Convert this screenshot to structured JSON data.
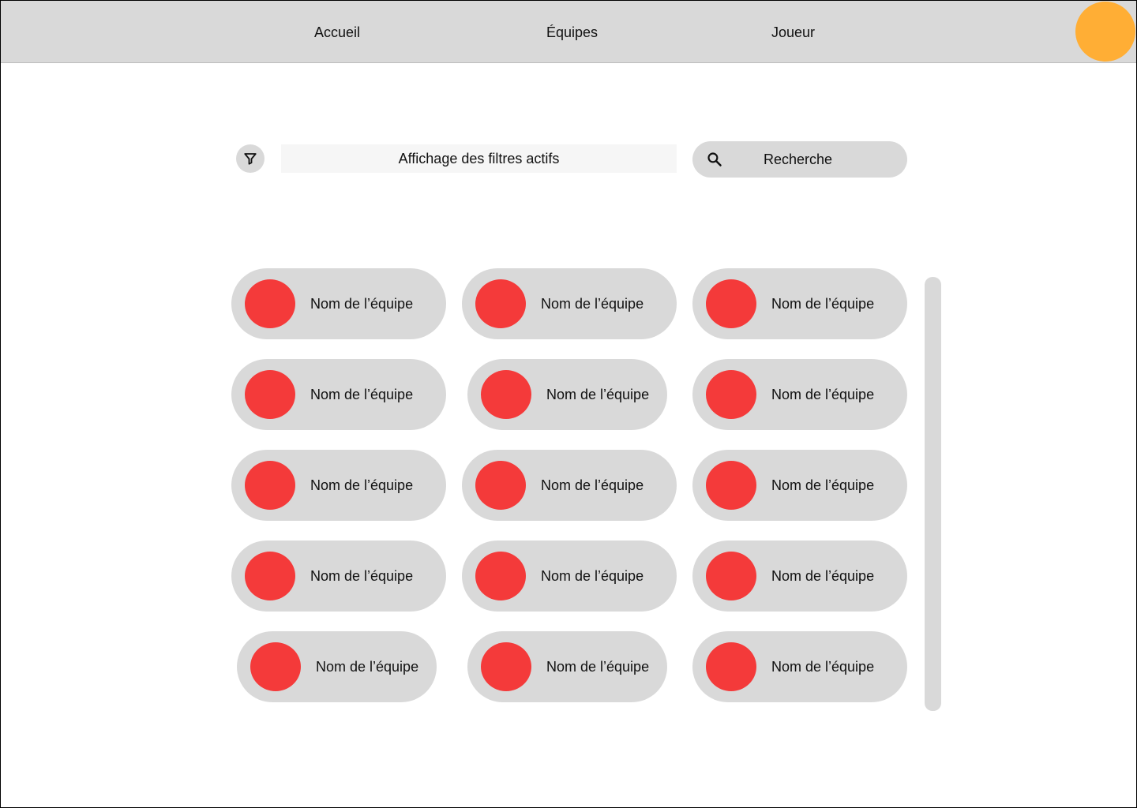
{
  "nav": {
    "links": [
      "Accueil",
      "Équipes",
      "Joueur"
    ],
    "avatar_color": "#ffae35"
  },
  "toolbar": {
    "filter_icon": "filter-icon",
    "active_filters_label": "Affichage des filtres actifs",
    "search_icon": "search-icon",
    "search_placeholder": "Recherche"
  },
  "teams": {
    "logo_color": "#f43a3a",
    "items": [
      "Nom de l’équipe",
      "Nom de l’équipe",
      "Nom de l’équipe",
      "Nom de l’équipe",
      "Nom de l’équipe",
      "Nom de l’équipe",
      "Nom de l’équipe",
      "Nom de l’équipe",
      "Nom de l’équipe",
      "Nom de l’équipe",
      "Nom de l’équipe",
      "Nom de l’équipe",
      "Nom de l’équipe",
      "Nom de l’équipe",
      "Nom de l’équipe"
    ]
  }
}
